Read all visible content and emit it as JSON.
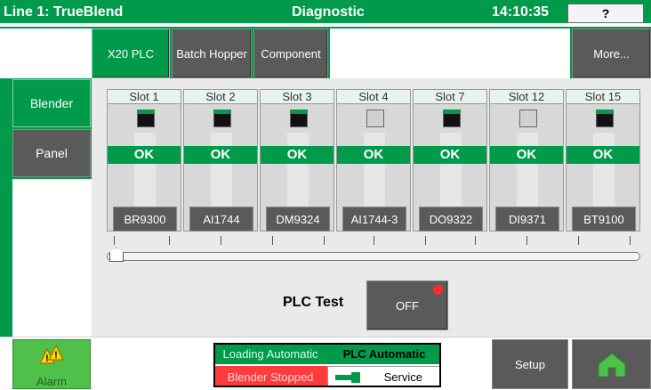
{
  "header": {
    "line_title": "Line 1: TrueBlend",
    "screen_title": "Diagnostic",
    "time": "14:10:35",
    "help_label": "?"
  },
  "tabs": [
    {
      "label": "X20 PLC",
      "active": true
    },
    {
      "label": "Batch Hopper",
      "active": false
    },
    {
      "label": "Component",
      "active": false
    }
  ],
  "more_label": "More...",
  "sidebar": {
    "items": [
      {
        "label": "Blender",
        "active": true
      },
      {
        "label": "Panel",
        "active": false
      }
    ]
  },
  "slots": [
    {
      "label": "Slot 1",
      "status": "OK",
      "led_on": true,
      "module": "BR9300"
    },
    {
      "label": "Slot 2",
      "status": "OK",
      "led_on": true,
      "module": "AI1744"
    },
    {
      "label": "Slot 3",
      "status": "OK",
      "led_on": true,
      "module": "DM9324"
    },
    {
      "label": "Slot 4",
      "status": "OK",
      "led_on": false,
      "module": "AI1744-3"
    },
    {
      "label": "Slot 7",
      "status": "OK",
      "led_on": true,
      "module": "DO9322"
    },
    {
      "label": "Slot 12",
      "status": "OK",
      "led_on": false,
      "module": "DI9371"
    },
    {
      "label": "Slot 15",
      "status": "OK",
      "led_on": true,
      "module": "BT9100"
    }
  ],
  "slider": {
    "value": 0
  },
  "plc_test": {
    "label": "PLC Test",
    "button": "OFF"
  },
  "footer": {
    "alarm_label": "Alarm",
    "loading": "Loading Automatic",
    "plc_automatic": "PLC Automatic",
    "blender_stopped": "Blender Stopped",
    "service": "Service",
    "setup": "Setup"
  },
  "colors": {
    "green": "#009a4a",
    "dark_button": "#5a5a5a",
    "red": "#ff3c3c",
    "led_off": "#d0d0d0"
  }
}
